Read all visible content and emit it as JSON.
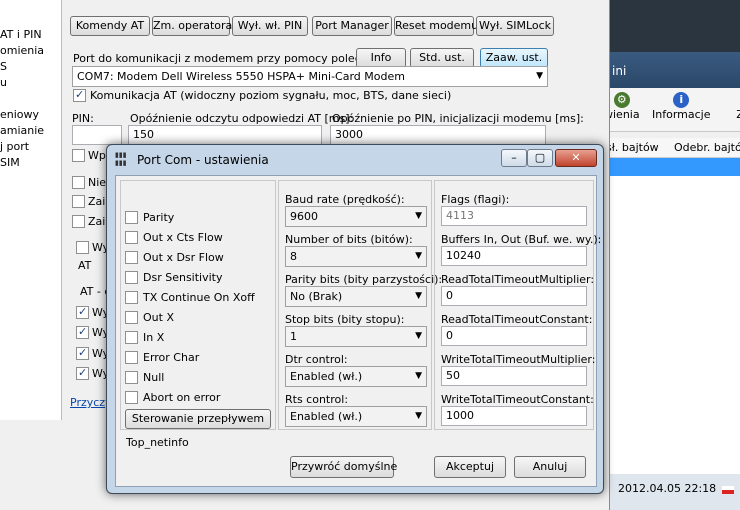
{
  "left_app": {
    "nav_items": [
      "AT i PIN",
      "omienia",
      "S",
      "u",
      "eniowy",
      "amianie",
      "j port",
      "SIM"
    ],
    "buttons": [
      "Komendy AT",
      "Zm. operatora",
      "Wył. wł. PIN",
      "Port Manager",
      "Reset modemu",
      "Wył. SIMLock"
    ],
    "port_label": "Port do komunikacji z modemem przy pomocy poleceń AT:",
    "port_buttons": [
      "Info",
      "Std. ust.",
      "Zaaw. ust."
    ],
    "port_value": "COM7: Modem Dell Wireless 5550 HSPA+ Mini-Card Modem",
    "at_comm_label": "Komunikacja AT (widoczny poziom sygnału, moc, BTS, dane sieci)",
    "pin_label": "PIN:",
    "delay_read_label": "Opóźnienie odczytu odpowiedzi AT [ms]:",
    "delay_read_value": "150",
    "delay_pin_label": "Opóźnienie po PIN, inicjalizacji modemu [ms]:",
    "delay_pin_value": "3000",
    "partial_labels": [
      "Wpr",
      "Nie",
      "Zaiı",
      "Zaiı",
      "Wy",
      "AT",
      "AT - d",
      "Wy",
      "Wy",
      "Wy",
      "Wy"
    ],
    "link_text": "Przyczyw"
  },
  "back_window": {
    "title": "ini",
    "toolbar": [
      {
        "label": "wienia",
        "icon": "settings-icon"
      },
      {
        "label": "Informacje",
        "icon": "info-icon"
      },
      {
        "label": "Z",
        "icon": "close-icon"
      }
    ],
    "columns": [
      "sł. bajtów",
      "Odebr. bajtów"
    ]
  },
  "taskbar": {
    "clock": "2012.04.05  22:18"
  },
  "dialog": {
    "title": "Port Com - ustawienia",
    "flags_left": [
      {
        "label": "Parity",
        "checked": false
      },
      {
        "label": "Out x Cts Flow",
        "checked": false
      },
      {
        "label": "Out x Dsr Flow",
        "checked": false
      },
      {
        "label": "Dsr Sensitivity",
        "checked": false
      },
      {
        "label": "TX Continue On Xoff",
        "checked": false
      },
      {
        "label": "Out X",
        "checked": false
      },
      {
        "label": "In X",
        "checked": false
      },
      {
        "label": "Error Char",
        "checked": false
      },
      {
        "label": "Null",
        "checked": false
      },
      {
        "label": "Abort on error",
        "checked": false
      }
    ],
    "flow_button": "Sterowanie przepływem",
    "baud_label": "Baud rate (prędkość):",
    "baud_value": "9600",
    "bits_label": "Number of bits (bitów):",
    "bits_value": "8",
    "parity_label": "Parity bits (bity parzystości):",
    "parity_value": "No (Brak)",
    "stop_label": "Stop bits (bity stopu):",
    "stop_value": "1",
    "dtr_label": "Dtr control:",
    "dtr_value": "Enabled (wł.)",
    "rts_label": "Rts control:",
    "rts_value": "Enabled (wł.)",
    "flags_label": "Flags (flagi):",
    "flags_value": "4113",
    "buffers_label": "Buffers In, Out (Buf. we. wy.):",
    "buffers_value": "10240",
    "rtm_label": "ReadTotalTimeoutMultiplier:",
    "rtm_value": "0",
    "rtc_label": "ReadTotalTimeoutConstant:",
    "rtc_value": "0",
    "wtm_label": "WriteTotalTimeoutMultiplier:",
    "wtm_value": "50",
    "wtc_label": "WriteTotalTimeoutConstant:",
    "wtc_value": "1000",
    "status_text": "Top_netinfo",
    "restore_button": "Przywróć domyślne",
    "ok_button": "Akceptuj",
    "cancel_button": "Anuluj"
  },
  "colors": {
    "selection": "#3399ff",
    "dialog_frame": "#c5d6e8"
  }
}
